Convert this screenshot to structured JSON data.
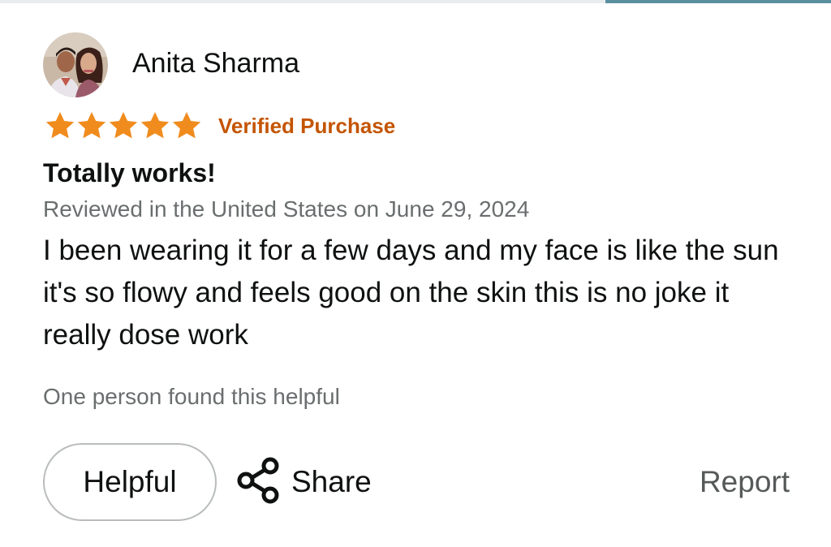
{
  "review": {
    "author": "Anita Sharma",
    "rating": 5,
    "rating_max": 5,
    "verified_label": "Verified Purchase",
    "title": "Totally works!",
    "meta": "Reviewed in the United States on June 29, 2024",
    "body": "I been wearing it for a few days and my face is like the sun it's so flowy and feels good on the skin this is no joke it really dose work",
    "helpful_count_text": "One person found this helpful"
  },
  "actions": {
    "helpful_label": "Helpful",
    "share_label": "Share",
    "report_label": "Report"
  },
  "colors": {
    "star": "#f08c1e",
    "verified": "#c45500",
    "meta": "#6a6e6f",
    "accent_bar": "#5a8fa0"
  },
  "icons": {
    "avatar": "avatar-photo",
    "star": "star-icon",
    "share": "share-icon"
  }
}
